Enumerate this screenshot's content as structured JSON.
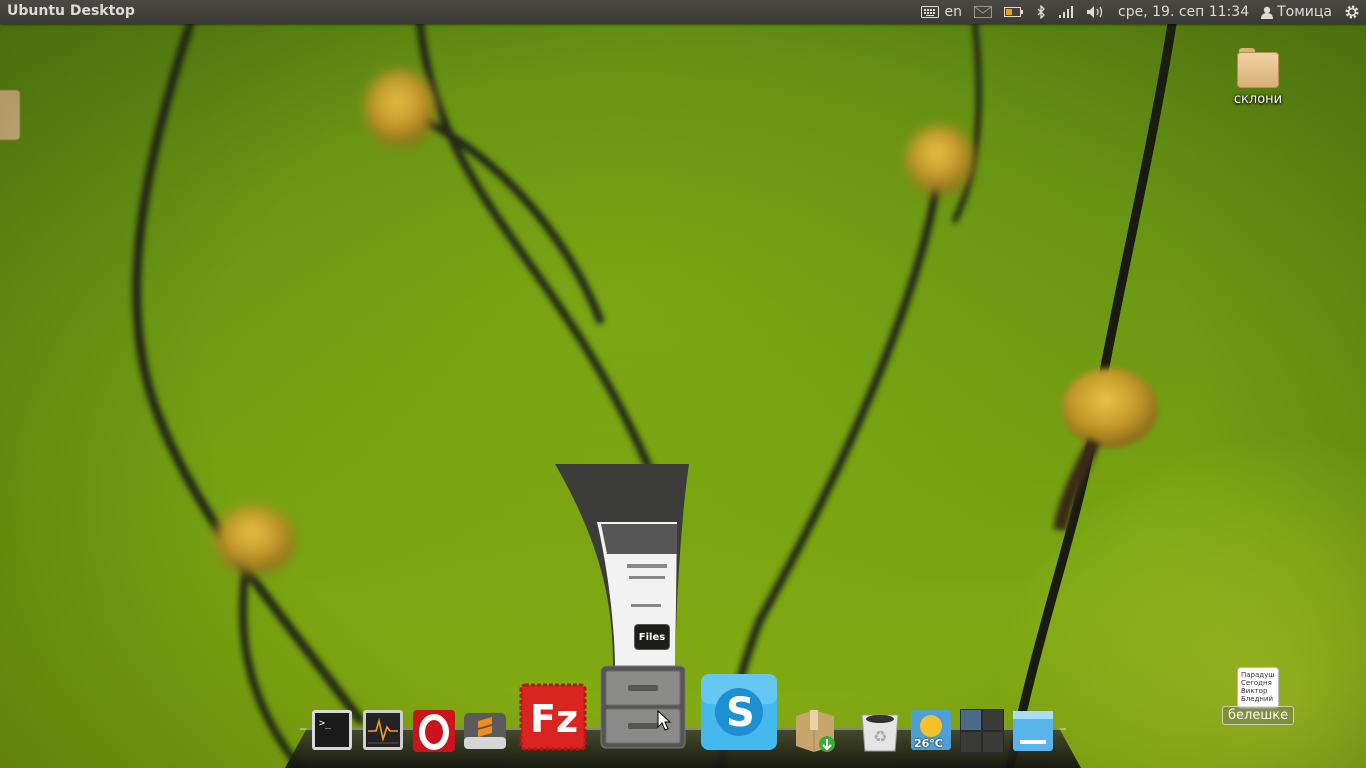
{
  "panel": {
    "app_title": "Ubuntu Desktop",
    "keyboard_layout": "en",
    "datetime": "сре, 19. сеп 11:34",
    "user_name": "Томица"
  },
  "desktop_icons": [
    {
      "label": "склони",
      "icon": "folder-icon"
    },
    {
      "label": "белешке",
      "icon": "note-icon",
      "note_lines": [
        "Парадуш",
        "Сегодня",
        "Виктор",
        "Бледний"
      ]
    }
  ],
  "dock": {
    "items": [
      {
        "name": "terminal",
        "icon": "terminal-icon"
      },
      {
        "name": "system-monitor",
        "icon": "system-monitor-icon"
      },
      {
        "name": "opera",
        "icon": "opera-icon"
      },
      {
        "name": "sublime",
        "icon": "sublime-text-icon"
      },
      {
        "name": "filezilla",
        "icon": "filezilla-icon"
      },
      {
        "name": "files",
        "icon": "file-cabinet-icon"
      },
      {
        "name": "skype",
        "icon": "skype-icon"
      },
      {
        "name": "package-installer",
        "icon": "package-download-icon"
      },
      {
        "name": "trash",
        "icon": "trash-icon"
      },
      {
        "name": "weather",
        "icon": "weather-icon",
        "temperature": "26°C"
      },
      {
        "name": "workspaces",
        "icon": "workspace-switcher-icon"
      },
      {
        "name": "show-desktop",
        "icon": "desktop-icon"
      }
    ],
    "tooltip": "Files"
  },
  "colors": {
    "panel_bg": "#3c3b37",
    "panel_text": "#dfdbd2",
    "wallpaper_green": "#6b9714",
    "filezilla_red": "#d9241f",
    "skype_blue": "#2fa9e6"
  }
}
